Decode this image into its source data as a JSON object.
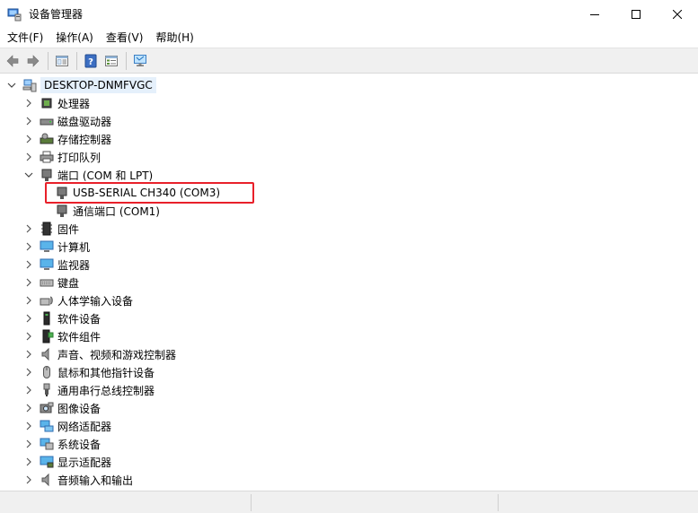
{
  "window": {
    "title": "设备管理器",
    "controls": [
      "minimize-icon",
      "maximize-icon",
      "close-icon"
    ]
  },
  "menu": [
    {
      "label": "文件(F)"
    },
    {
      "label": "操作(A)"
    },
    {
      "label": "查看(V)"
    },
    {
      "label": "帮助(H)"
    }
  ],
  "toolbar": {
    "buttons": [
      "back-arrow-icon",
      "forward-arrow-icon",
      "properties-icon",
      "help-icon",
      "list-icon",
      "monitor-icon"
    ]
  },
  "tree": {
    "root": "DESKTOP-DNMFVGC",
    "categories": {
      "processors": "处理器",
      "disk_drives": "磁盘驱动器",
      "storage_controllers": "存储控制器",
      "print_queues": "打印队列",
      "ports": "端口 (COM 和 LPT)",
      "port_usb_serial": "USB-SERIAL CH340 (COM3)",
      "port_com1": "通信端口 (COM1)",
      "firmware": "固件",
      "computer": "计算机",
      "monitors": "监视器",
      "keyboards": "键盘",
      "hid": "人体学输入设备",
      "software_devices": "软件设备",
      "software_components": "软件组件",
      "sound_video_game": "声音、视频和游戏控制器",
      "mice": "鼠标和其他指针设备",
      "usb_controllers": "通用串行总线控制器",
      "imaging": "图像设备",
      "network_adapters": "网络适配器",
      "system_devices": "系统设备",
      "display_adapters": "显示适配器",
      "audio_io": "音频输入和输出"
    },
    "highlight_color": "#e8202a",
    "selection_color": "#e5f0fb"
  }
}
